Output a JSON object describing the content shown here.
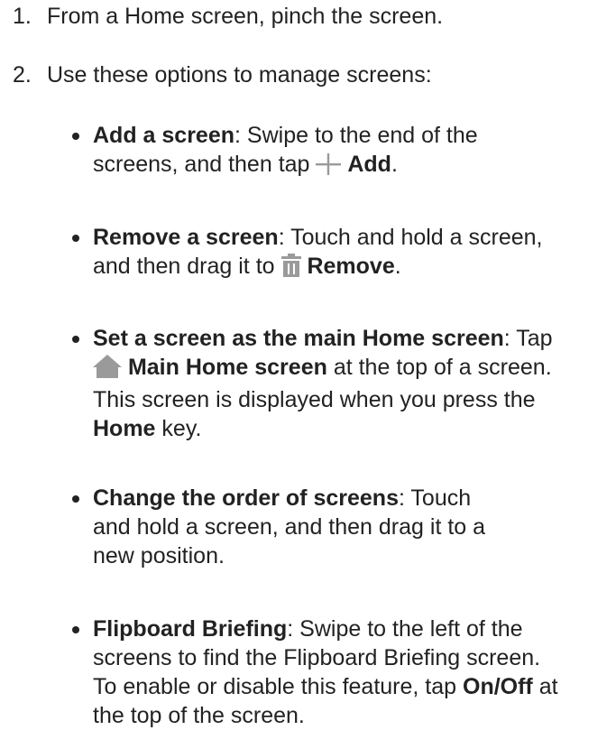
{
  "steps": [
    {
      "number": "1.",
      "text": "From a Home screen, pinch the screen."
    },
    {
      "number": "2.",
      "text": "Use these options to manage screens:"
    }
  ],
  "bullets": {
    "add": {
      "title": "Add a screen",
      "line1_rest": ": Swipe to the end of the",
      "line2_pre": "screens, and then tap",
      "action": "Add",
      "end": ".",
      "icon": "plus-icon"
    },
    "remove": {
      "title": "Remove a screen",
      "line1_rest": ": Touch and hold a screen,",
      "line2_pre": "and then drag it to",
      "action": "Remove",
      "end": ".",
      "icon": "trash-icon"
    },
    "main_home": {
      "title": "Set a screen as the main Home screen",
      "line1_rest": ": Tap",
      "action": "Main Home screen",
      "line2_rest": " at the top of a screen.",
      "line3": "This screen is displayed when you press the",
      "line4_bold": "Home",
      "line4_rest": " key.",
      "icon": "home-icon"
    },
    "order": {
      "title": "Change the order of screens",
      "line1_rest": ": Touch",
      "line2": "and hold a screen, and then drag it to a",
      "line3": "new position."
    },
    "flipboard": {
      "title": "Flipboard Briefing",
      "line1_rest": ": Swipe to the left of the",
      "line2": "screens to find the Flipboard Briefing screen.",
      "line3_pre": "To enable or disable this feature, tap",
      "line3_bold": "On/Off",
      "line3_post": " at",
      "line4": "the top of the screen."
    }
  },
  "colors": {
    "text": "#222222",
    "icon": "#9a9a9a"
  }
}
